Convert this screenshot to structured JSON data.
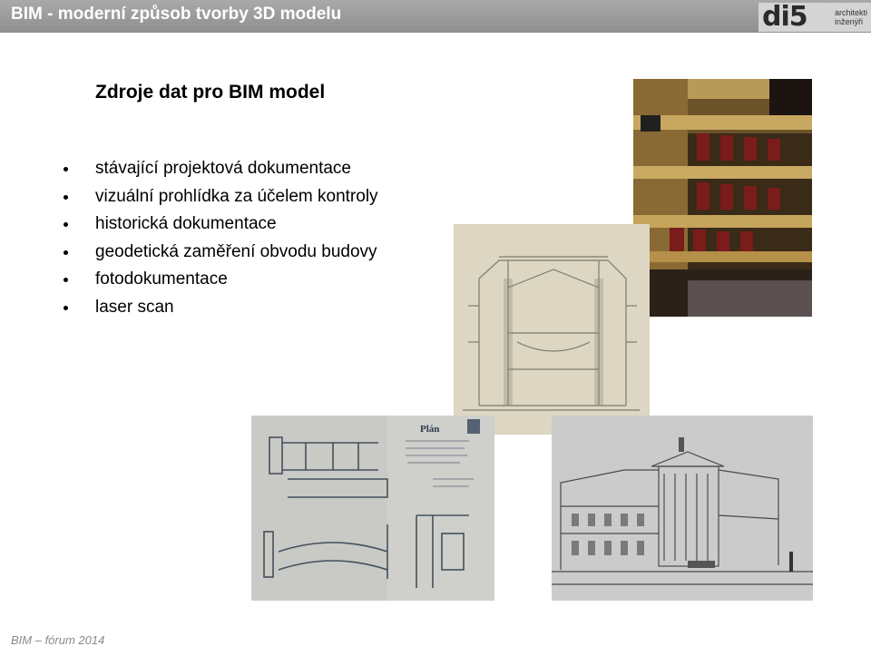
{
  "header": {
    "title": "BIM - moderní způsob tvorby 3D modelu",
    "logo": {
      "mark": "di5",
      "line1": "architekti",
      "line2": "inženýři"
    }
  },
  "slide": {
    "title": "Zdroje dat pro BIM model",
    "bullets": [
      "stávající projektová dokumentace",
      "vizuální prohlídka za účelem kontroly",
      "historická dokumentace",
      "geodetická zaměření obvodu budovy",
      "fotodokumentace",
      "laser scan"
    ]
  },
  "images": {
    "plan_stamp": "Plán"
  },
  "footer": {
    "text": "BIM – fórum 2014"
  },
  "colors": {
    "header_bg": "#999999",
    "header_text": "#ffffff",
    "footer_text": "#8a8a8a"
  }
}
